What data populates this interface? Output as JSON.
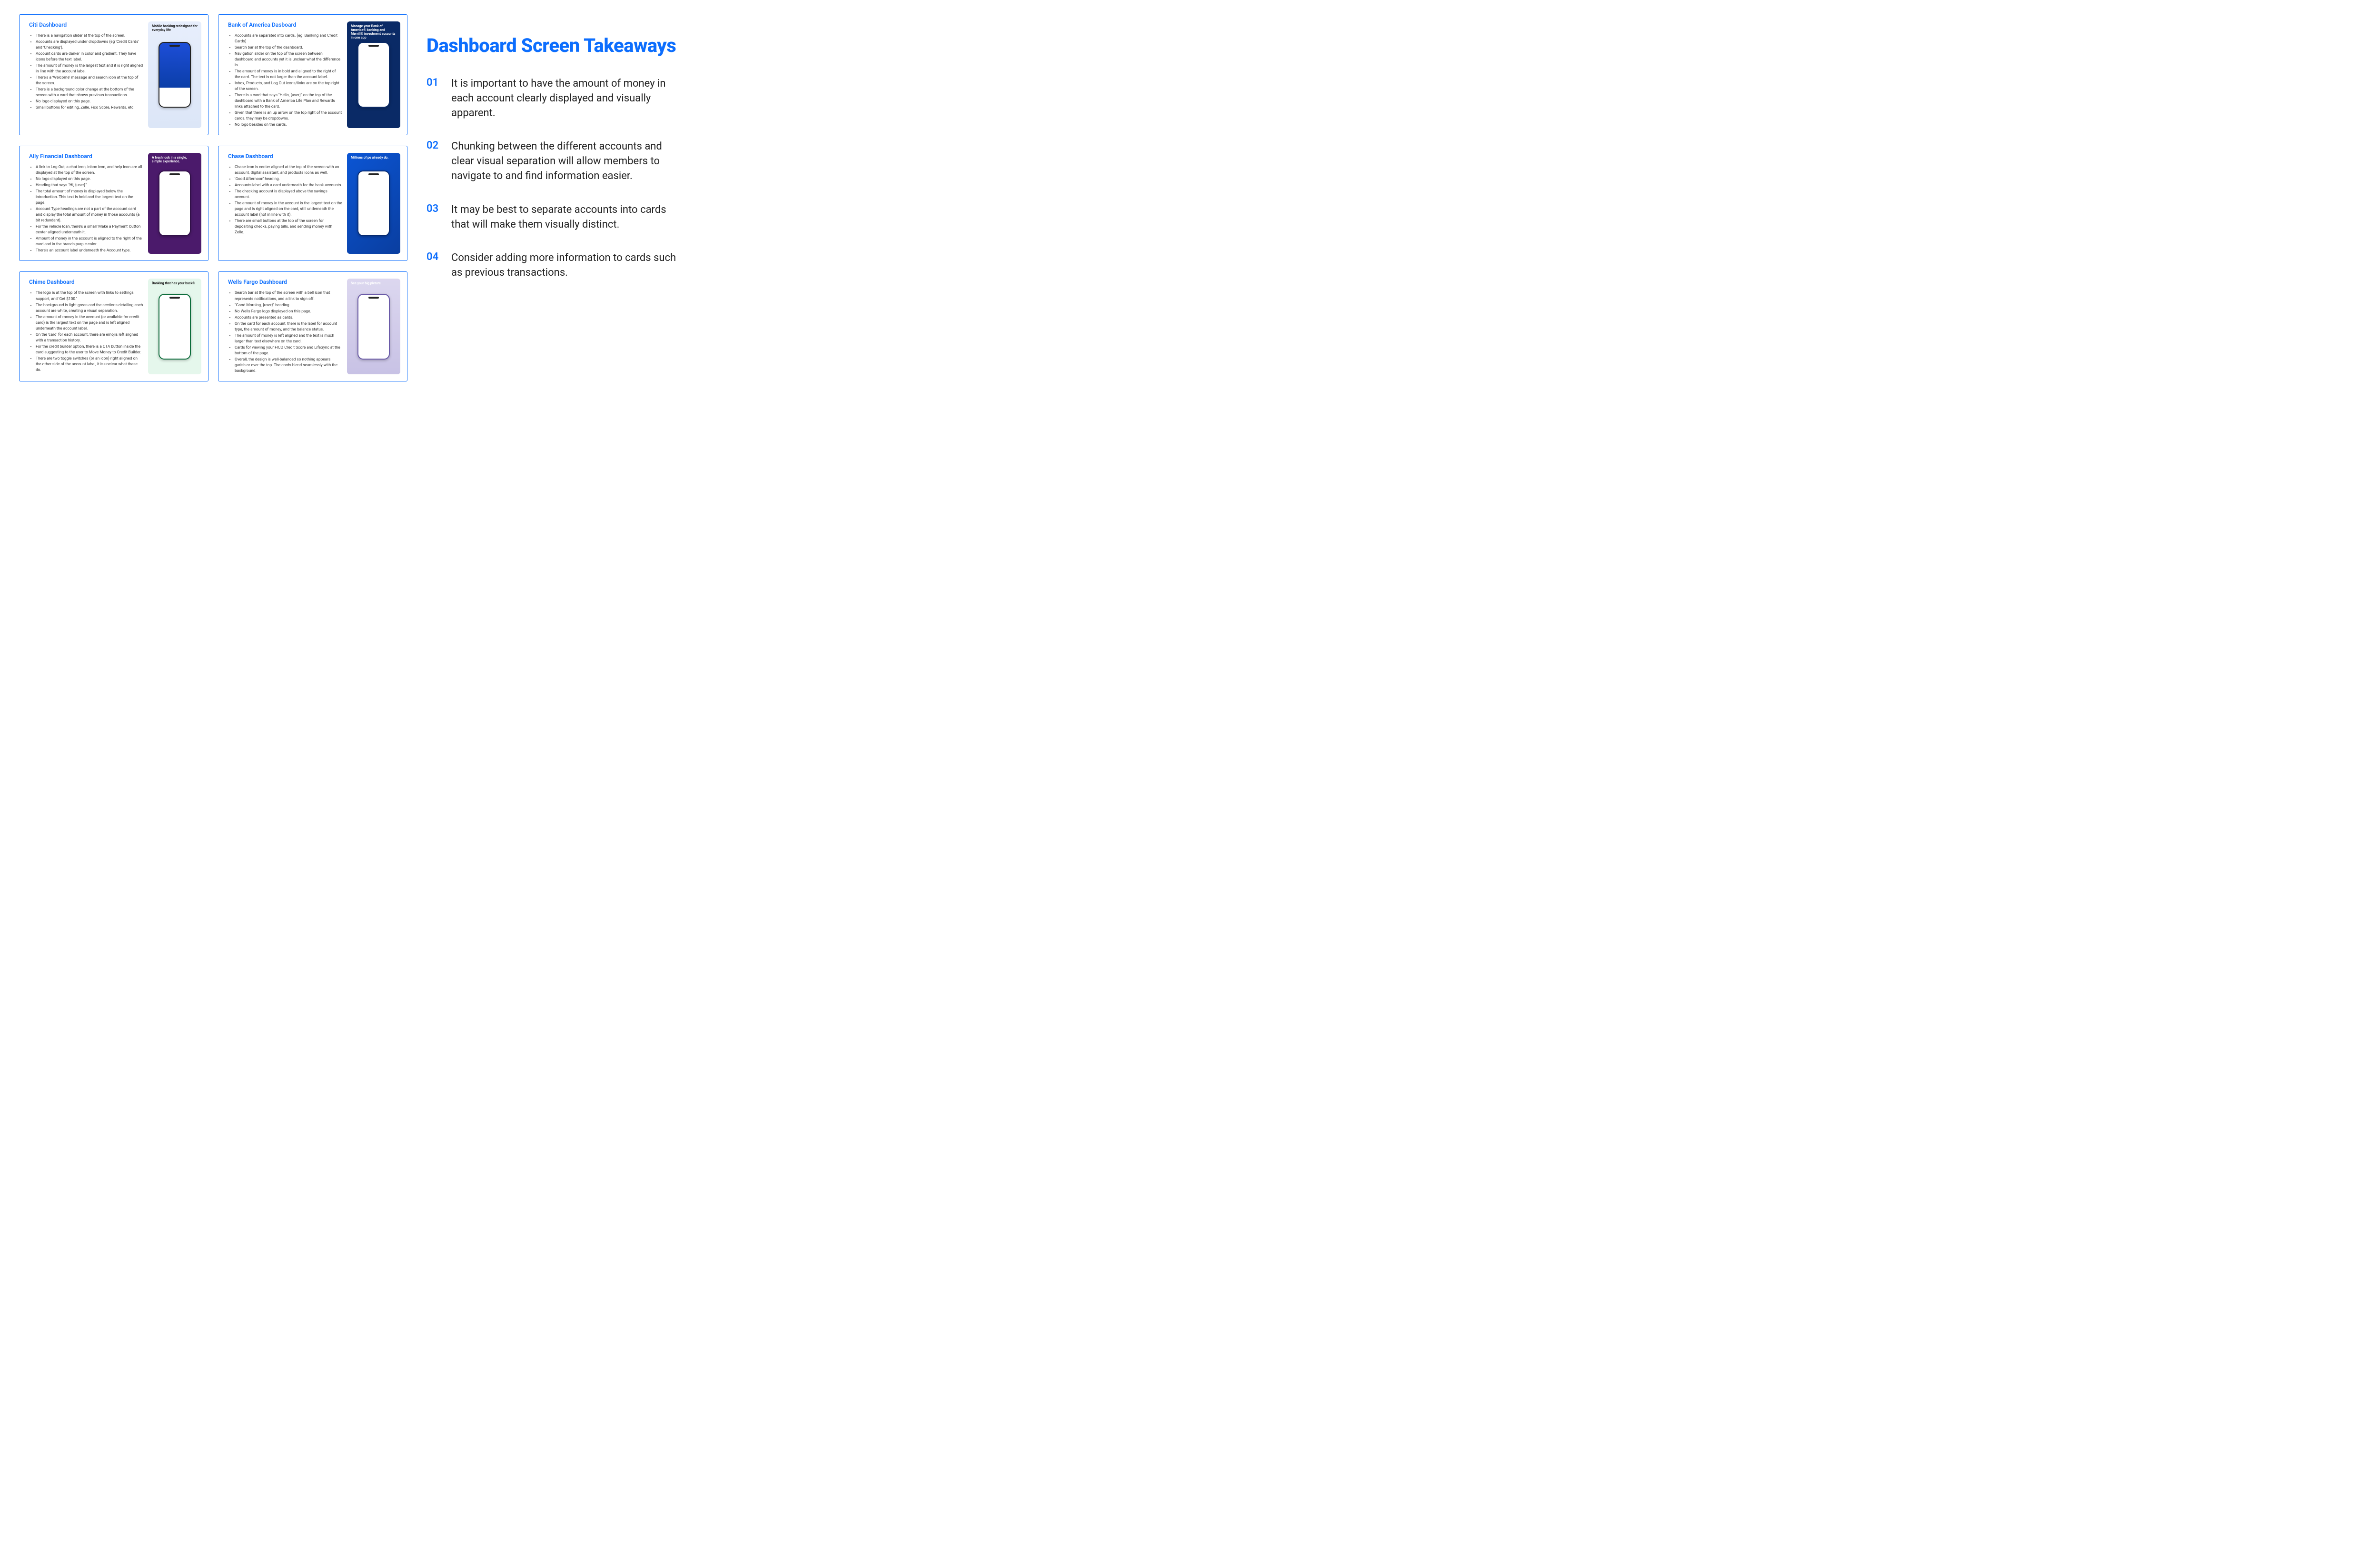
{
  "cards": [
    {
      "title": "Citi Dashboard",
      "image_class": "img-citi",
      "image_caption": "Mobile banking redesigned for everyday life",
      "caption_dark": true,
      "bullets": [
        "There is a navigation slider at the top of the screen.",
        "Accounts are displayed under dropdowns (eg 'Credit Cards' and 'Checking').",
        "Account cards are darker in color and gradient. They have icons before the text label.",
        "The amount of money is the largest text and it is right aligned in line with the account label.",
        "There's a 'Welcome' message and search icon at the top of the screen.",
        "There is a background color change at the bottom of the screen with a card that shows previous transactions.",
        "No logo displayed on this page.",
        "Small buttons for editing, Zelle, Fico Score, Rewards, etc."
      ]
    },
    {
      "title": "Bank of America Dasboard",
      "image_class": "img-boa",
      "image_caption": "Manage your Bank of America® banking and Merrill® investment accounts in one app",
      "caption_dark": false,
      "bullets": [
        "Accounts are separated into cards. (eg. Banking and Credit Cards)",
        "Search bar at the top of the dashboard.",
        "Navigation slider on the top of the screen between dashboard and accounts yet it is unclear what the difference is.",
        "The amount of money is in bold and aligned to the right of the card. The text is not larger than the account label.",
        "Inbox, Products, and Log Out icons/links are on the top right of the screen.",
        "There is a card that says \"Hello, {user}\" on the top of the dashboard with a Bank of America Life Plan and Rewards links attached to the card.",
        "Given that there is an up arrow on the top right of the account cards, they may be dropdowns.",
        "No logo besides on the cards."
      ]
    },
    {
      "title": "Ally Financial Dashboard",
      "image_class": "img-ally",
      "image_caption": "A fresh look in a single, simple experience.",
      "caption_dark": false,
      "bullets": [
        "A link to Log Out, a chat icon, inbox icon, and help icon are all displayed at the top of the screen.",
        "No logo displayed on this page.",
        "Heading that says \"Hi, {user}\"",
        "The total amount of money is displayed below the introduction. This text is bold and the largest text on the page.",
        "Account Type headings are not a part of the account card and display the total amount of money in those accounts (a bit redundant).",
        "For the vehicle loan, there's a small 'Make a Payment' button center aligned underneath it.",
        "Amount of money in the account is aligned to the right of the card and in the brands purple color.",
        "There's an account label underneath the Account type."
      ]
    },
    {
      "title": "Chase Dashboard",
      "image_class": "img-chase",
      "image_caption": "Millions of pe already do.",
      "caption_dark": false,
      "bullets": [
        "Chase icon is center aligned at the top of the screen with an account, digital assistant, and products icons as well.",
        "'Good Afternoon' heading.",
        "Accounts label with a card underneath for the bank accounts.",
        "The checking account is displayed above the savings account.",
        "The amount of money in the account is the largest text on the page and is right aligned on the card, still underneath the account label (not in line with it).",
        "There are small buttons at the top of the screen for depositing checks, paying bills, and sending money with Zelle."
      ]
    },
    {
      "title": "Chime Dashboard",
      "image_class": "img-chime",
      "image_caption": "Banking that has your back®",
      "caption_dark": true,
      "bullets": [
        "The logo is at the top of the screen with links to settings, support, and 'Get $100.'",
        "The background is light green and the sections detailing each account are white, creating a visual separation.",
        "The amount of money in the account (or available for credit card) is the largest text on the page and is left aligned underneath the account label.",
        "On the 'card' for each account, there are emojis left aligned with a transaction history.",
        "For the credit builder option, there is a CTA button inside the card suggesting to the user to Move Money to Credit Builder.",
        "There are two toggle switches (or an icon) right aligned on the other side of the account label, it is unclear what these do."
      ]
    },
    {
      "title": "Wells Fargo Dashboard",
      "image_class": "img-wf",
      "image_caption": "See your big picture",
      "caption_dark": false,
      "bullets": [
        "Search bar at the top of the screen with a bell icon that represents notifications, and a link to sign off.",
        "\"Good Morning, {user}\" heading.",
        "No Wells Fargo logo displayed on this page.",
        "Accounts are presented as cards.",
        "On the card for each account, there is the label for account type, the amount of money, and the balance status.",
        "The amount of money is left aligned and the text is much larger than text elsewhere on the card.",
        "Cards for viewing your FICO Credit Score and LifeSync at the bottom of the page.",
        "Overall, the design is well-balanced so nothing appears garish or over the top. The cards blend seamlessly with the background."
      ]
    }
  ],
  "right": {
    "title": "Dashboard Screen Takeaways",
    "items": [
      {
        "num": "01",
        "text": "It is important to have the amount of money in each account clearly displayed and visually apparent."
      },
      {
        "num": "02",
        "text": "Chunking between the different accounts and clear visual separation will allow members to navigate to and find information easier."
      },
      {
        "num": "03",
        "text": "It may be best to separate accounts into cards that will make them visually distinct."
      },
      {
        "num": "04",
        "text": "Consider adding more information to cards such as previous transactions."
      }
    ]
  }
}
